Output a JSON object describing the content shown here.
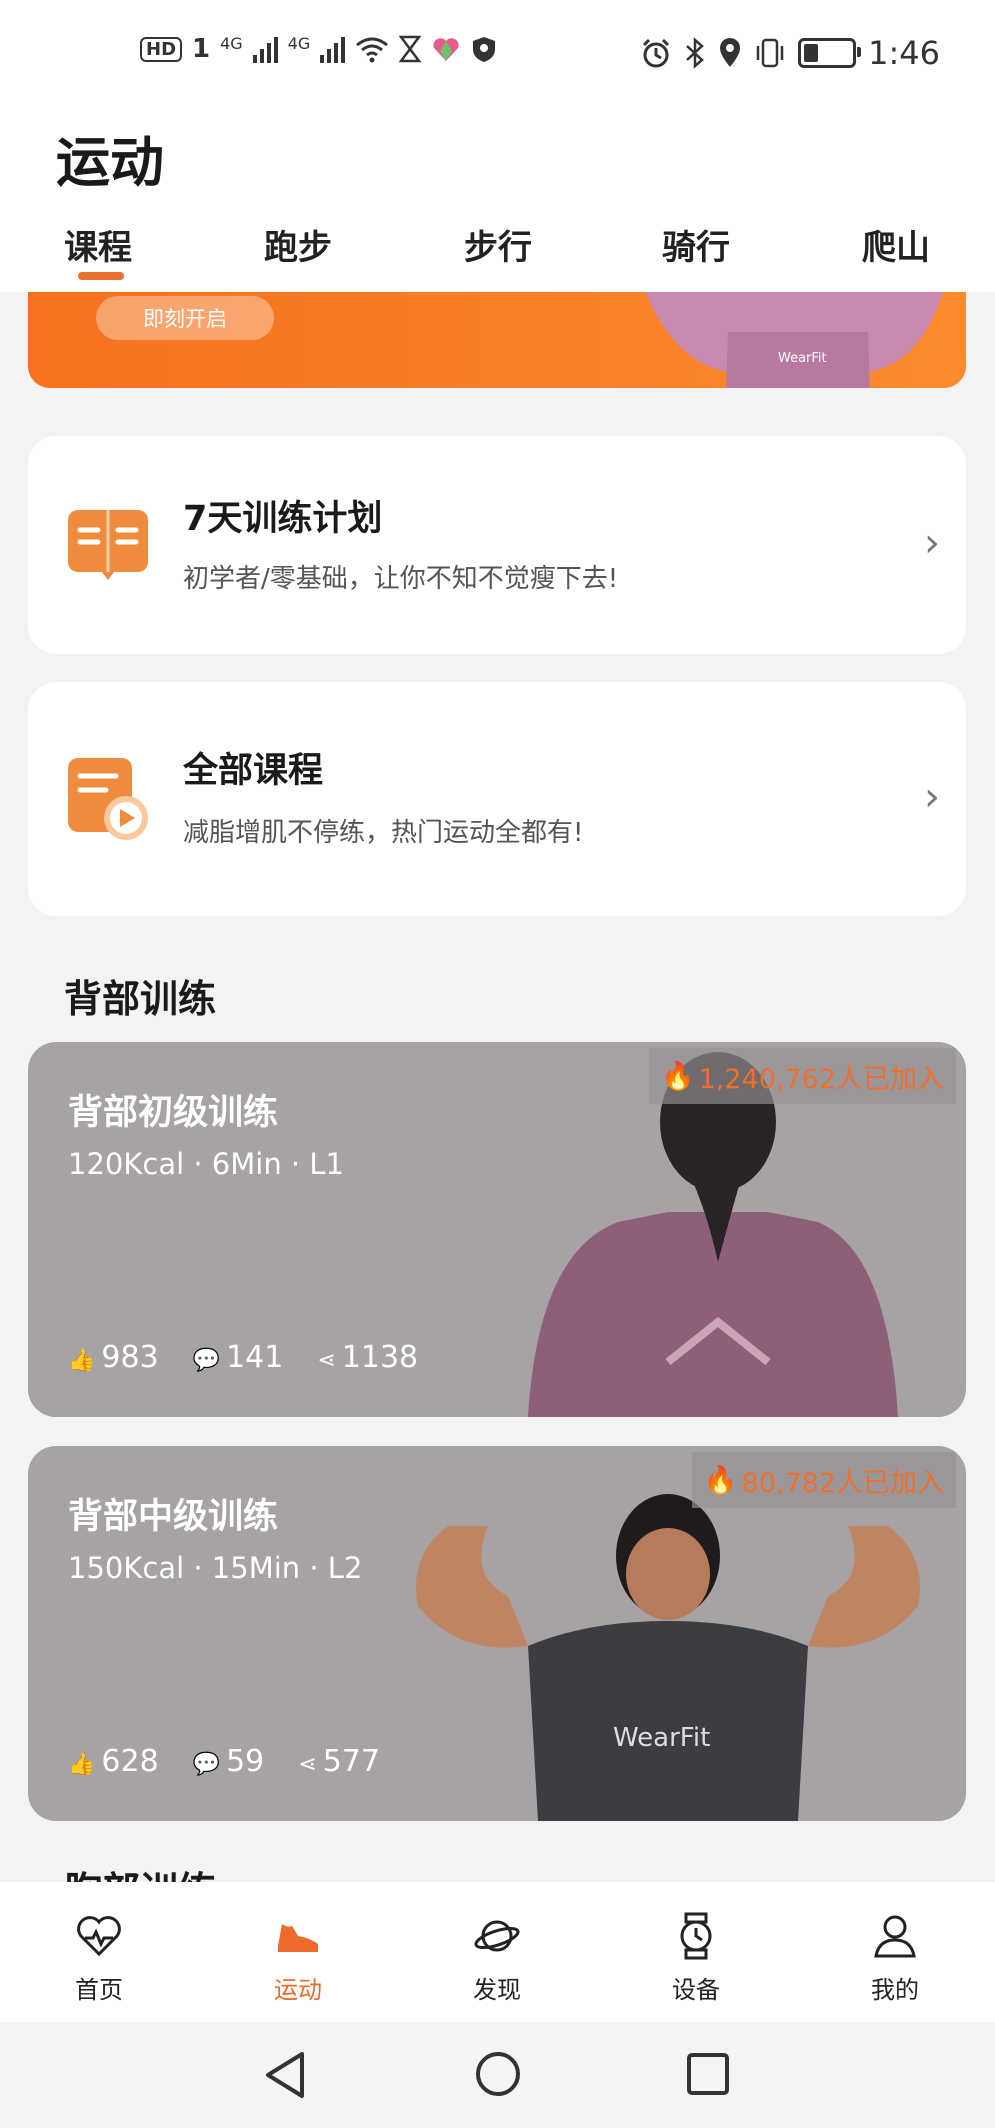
{
  "status_bar": {
    "left_badges": [
      "HD",
      "1",
      "4G",
      "4G"
    ],
    "time": "1:46",
    "battery_level": 0.35
  },
  "header": {
    "title": "运动",
    "tabs": [
      {
        "label": "课程",
        "active": true
      },
      {
        "label": "跑步",
        "active": false
      },
      {
        "label": "步行",
        "active": false
      },
      {
        "label": "骑行",
        "active": false
      },
      {
        "label": "爬山",
        "active": false
      }
    ]
  },
  "banner": {
    "button_label": "即刻开启",
    "brand": "WearFit",
    "accent": "#f7711f"
  },
  "cards": [
    {
      "title": "7天训练计划",
      "subtitle": "初学者/零基础，让你不知不觉瘦下去!",
      "icon": "book-icon"
    },
    {
      "title": "全部课程",
      "subtitle": "减脂增肌不停练，热门运动全都有!",
      "icon": "video-list-icon"
    }
  ],
  "section": {
    "title": "背部训练",
    "next_title_partial": "胸部训练"
  },
  "workouts": [
    {
      "title": "背部初级训练",
      "meta": "120Kcal · 6Min · L1",
      "joined": "1,240,762人已加入",
      "likes": "983",
      "comments": "141",
      "shares": "1138"
    },
    {
      "title": "背部中级训练",
      "meta": "150Kcal · 15Min · L2",
      "joined": "80,782人已加入",
      "likes": "628",
      "comments": "59",
      "shares": "577",
      "shirt_brand": "WearFit"
    }
  ],
  "bottom_nav": [
    {
      "label": "首页",
      "icon": "heart-pulse-icon",
      "active": false
    },
    {
      "label": "运动",
      "icon": "shoe-icon",
      "active": true
    },
    {
      "label": "发现",
      "icon": "planet-icon",
      "active": false
    },
    {
      "label": "设备",
      "icon": "watch-icon",
      "active": false
    },
    {
      "label": "我的",
      "icon": "person-icon",
      "active": false
    }
  ],
  "colors": {
    "accent": "#ec6a2a",
    "card_overlay": "#a7a3a4"
  }
}
